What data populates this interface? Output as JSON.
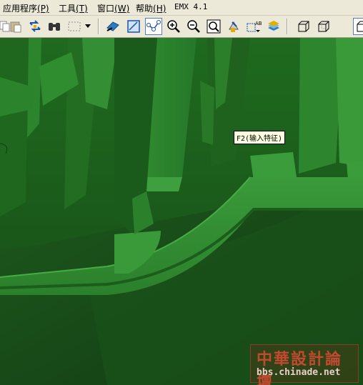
{
  "menu": [
    {
      "label": "应用程序",
      "key": "(P)"
    },
    {
      "label": "工具",
      "key": "(T)"
    },
    {
      "label": "窗口",
      "key": "(W)"
    },
    {
      "label": "帮助",
      "key": "(H)"
    },
    {
      "label": "EMX 4.1",
      "key": ""
    }
  ],
  "toolbar": {
    "buttons": [
      "copy-icon",
      "paste-icon",
      "regenerate-icon",
      "binoculars-icon",
      "select-box-icon",
      "dropdown-arrow-icon",
      "datum-display-icon",
      "sketch-icon",
      "datum-axis-icon",
      "zoom-in-icon",
      "zoom-out-icon",
      "refit-icon",
      "orient-icon",
      "saved-views-icon",
      "layers-icon",
      "wireframe-icon",
      "hidden-line-icon",
      "no-hidden-icon"
    ],
    "active": "datum-axis-icon"
  },
  "tooltip": {
    "text": "F2(输入特征)"
  },
  "watermark": {
    "title": "中華設計論壇",
    "url": "bbs.chinade.net"
  },
  "colors": {
    "model_green": "#2e8a2e",
    "background_green": "#1d5a1d",
    "tooltip_bg": "#ffffe1"
  }
}
